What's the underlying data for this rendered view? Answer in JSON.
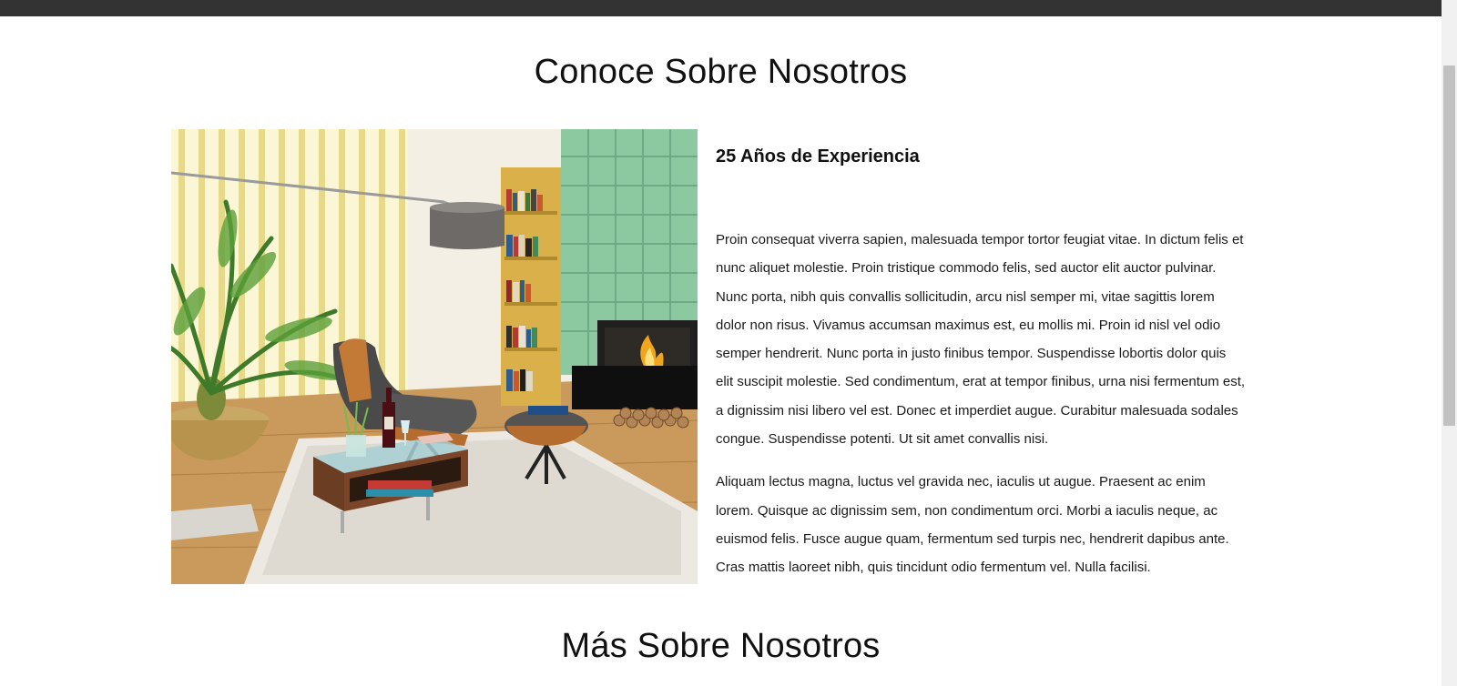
{
  "section_about": {
    "title": "Conoce Sobre Nosotros",
    "subheading": "25 Años de Experiencia",
    "paragraphs": [
      "Proin consequat viverra sapien, malesuada tempor tortor feugiat vitae. In dictum felis et nunc aliquet molestie. Proin tristique commodo felis, sed auctor elit auctor pulvinar. Nunc porta, nibh quis convallis sollicitudin, arcu nisl semper mi, vitae sagittis lorem dolor non risus. Vivamus accumsan maximus est, eu mollis mi. Proin id nisl vel odio semper hendrerit. Nunc porta in justo finibus tempor. Suspendisse lobortis dolor quis elit suscipit molestie. Sed condimentum, erat at tempor finibus, urna nisi fermentum est, a dignissim nisi libero vel est. Donec et imperdiet augue. Curabitur malesuada sodales congue. Suspendisse potenti. Ut sit amet convallis nisi.",
      "Aliquam lectus magna, luctus vel gravida nec, iaculis ut augue. Praesent ac enim lorem. Quisque ac dignissim sem, non condimentum orci. Morbi a iaculis neque, ac euismod felis. Fusce augue quam, fermentum sed turpis nec, hendrerit dapibus ante. Cras mattis laoreet nibh, quis tincidunt odio fermentum vel. Nulla facilisi."
    ]
  },
  "section_more": {
    "title": "Más Sobre Nosotros"
  },
  "colors": {
    "top_bar": "#333333",
    "text": "#111111",
    "accent_green": "#8cc9a0"
  }
}
